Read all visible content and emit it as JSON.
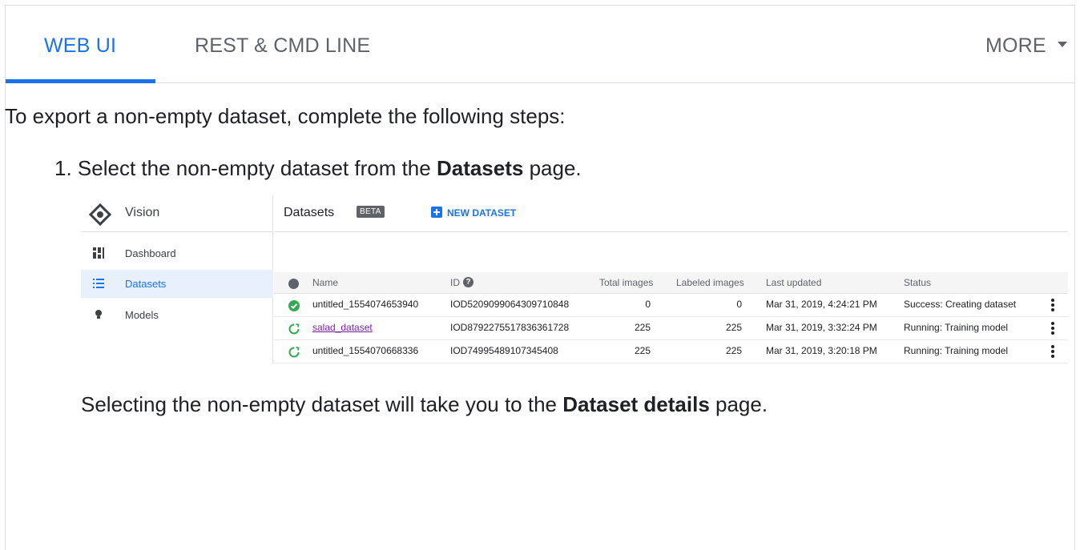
{
  "tabs": [
    {
      "label": "WEB UI",
      "active": true
    },
    {
      "label": "REST & CMD LINE",
      "active": false
    }
  ],
  "more_label": "MORE",
  "intro_text": "To export a non-empty dataset, complete the following steps:",
  "step1": {
    "number": "1.",
    "before": "Select the non-empty dataset from the",
    "bold": "Datasets",
    "after": "page."
  },
  "followup": {
    "before": "Selecting the non-empty dataset will take you to the",
    "bold": "Dataset details",
    "after": "page."
  },
  "console": {
    "product_title": "Vision",
    "nav": [
      {
        "label": "Dashboard",
        "icon": "dashboard-icon",
        "active": false
      },
      {
        "label": "Datasets",
        "icon": "list-icon",
        "active": true
      },
      {
        "label": "Models",
        "icon": "lightbulb-icon",
        "active": false
      }
    ],
    "page_title": "Datasets",
    "badge": "BETA",
    "new_button": "NEW DATASET",
    "columns": [
      "Name",
      "ID",
      "Total images",
      "Labeled images",
      "Last updated",
      "Status"
    ],
    "rows": [
      {
        "status_icon": "success-check-icon",
        "name": "untitled_1554074653940",
        "id": "IOD5209099064309710848",
        "total": "0",
        "labeled": "0",
        "updated": "Mar 31, 2019, 4:24:21 PM",
        "status": "Success: Creating dataset",
        "link": false
      },
      {
        "status_icon": "running-icon",
        "name": "salad_dataset",
        "id": "IOD8792275517836361728",
        "total": "225",
        "labeled": "225",
        "updated": "Mar 31, 2019, 3:32:24 PM",
        "status": "Running: Training model",
        "link": true
      },
      {
        "status_icon": "running-icon",
        "name": "untitled_1554070668336",
        "id": "IOD74995489107345408",
        "total": "225",
        "labeled": "225",
        "updated": "Mar 31, 2019, 3:20:18 PM",
        "status": "Running: Training model",
        "link": false
      }
    ]
  },
  "colors": {
    "accent": "#1a73e8",
    "success": "#34a853",
    "link_visited": "#7b1fa2"
  }
}
